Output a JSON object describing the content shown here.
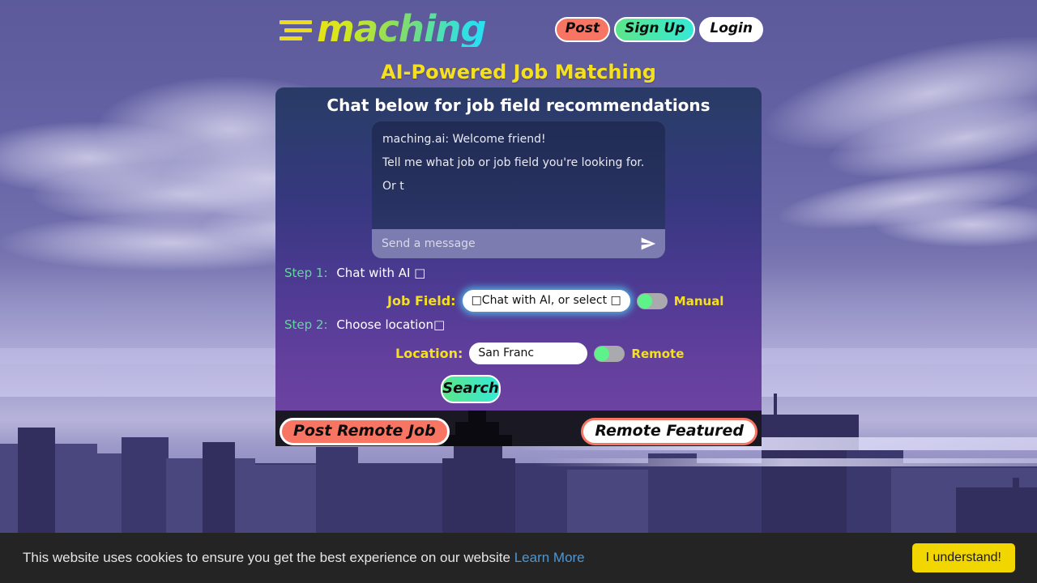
{
  "header": {
    "logo_text": "maching",
    "logo_icon": "speed-lines-icon",
    "nav": {
      "post": "Post",
      "signup": "Sign Up",
      "login": "Login"
    }
  },
  "tagline": "AI-Powered Job Matching",
  "panel": {
    "heading": "Chat below for job field recommendations",
    "chat": {
      "messages": [
        "maching.ai: Welcome friend!",
        "Tell me what job or job field you're looking for.",
        "Or t"
      ],
      "input_value": "",
      "input_placeholder": "Send a message",
      "send_icon": "paper-plane-icon"
    },
    "steps": [
      {
        "label": "Step 1:",
        "text": "Chat with AI □"
      },
      {
        "label": "Step 2:",
        "text": "Choose location□"
      }
    ],
    "job_field": {
      "label": "Job Field:",
      "select_value": "□Chat with AI, or select □",
      "toggle_label": "Manual",
      "toggle_state": "off"
    },
    "location": {
      "label": "Location:",
      "input_value": "San Franc",
      "toggle_label": "Remote",
      "toggle_state": "off"
    },
    "search_button": "Search"
  },
  "panel_footer": {
    "post_remote_job": "Post Remote Job",
    "remote_featured": "Remote Featured"
  },
  "cookie_banner": {
    "message": "This website uses cookies to ensure you get the best experience on our website",
    "link": "Learn More",
    "accept_button": "I understand!"
  },
  "colors": {
    "accent_yellow": "#f4e01e",
    "accent_green": "#63d69b",
    "accent_coral": "#f87563",
    "accent_cyan": "#35e8d6",
    "cookie_button": "#f2d600",
    "cookie_link": "#4c97d4"
  }
}
